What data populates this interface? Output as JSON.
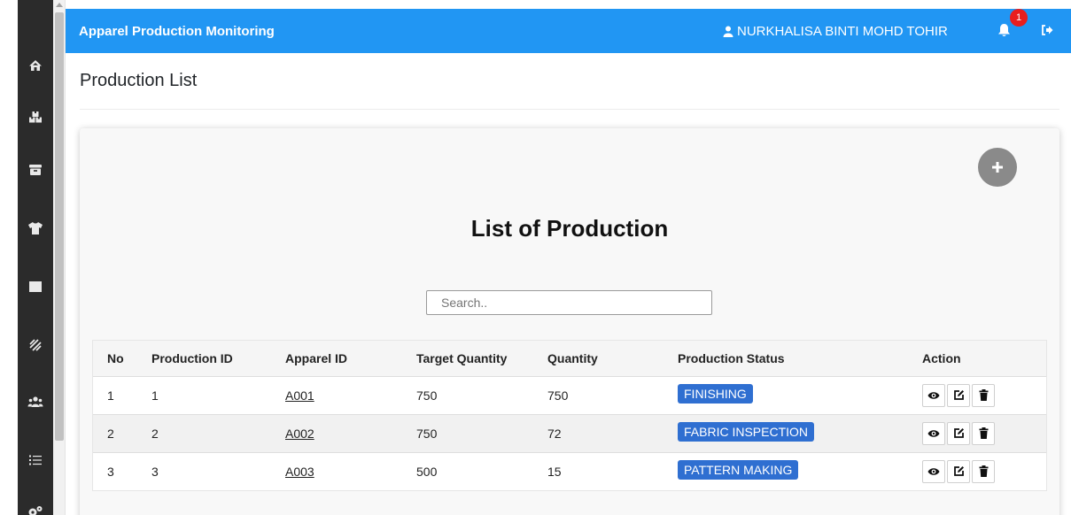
{
  "header": {
    "brand": "Apparel Production Monitoring",
    "user_name": "NURKHALISA BINTI MOHD TOHIR",
    "notification_count": "1"
  },
  "sidebar": {
    "icons": [
      "home-icon",
      "boxes-icon",
      "archive-icon",
      "tshirt-icon",
      "square-icon",
      "layers-icon",
      "users-icon",
      "list-icon",
      "cogs-icon"
    ]
  },
  "page": {
    "title": "Production List"
  },
  "card": {
    "title": "List of Production",
    "search_placeholder": "Search.."
  },
  "table": {
    "headers": [
      "No",
      "Production ID",
      "Apparel ID",
      "Target Quantity",
      "Quantity",
      "Production Status",
      "Action"
    ],
    "rows": [
      {
        "no": "1",
        "production_id": "1",
        "apparel_id": "A001",
        "target_quantity": "750",
        "quantity": "750",
        "status": "FINISHING"
      },
      {
        "no": "2",
        "production_id": "2",
        "apparel_id": "A002",
        "target_quantity": "750",
        "quantity": "72",
        "status": "FABRIC INSPECTION"
      },
      {
        "no": "3",
        "production_id": "3",
        "apparel_id": "A003",
        "target_quantity": "500",
        "quantity": "15",
        "status": "PATTERN MAKING"
      }
    ]
  },
  "colors": {
    "topbar": "#2196f3",
    "sidebar": "#2b2b2b",
    "status_badge": "#2f6fd1",
    "notification_badge": "#e91e1e",
    "add_button": "#8a8a8a"
  }
}
